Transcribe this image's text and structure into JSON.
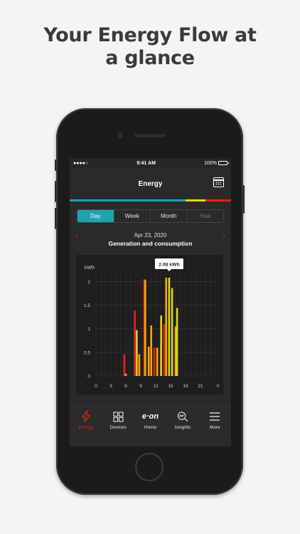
{
  "headline": {
    "line1": "Your Energy Flow at",
    "line2": "a glance"
  },
  "status_bar": {
    "signal": "●●●●○",
    "time": "9:41 AM",
    "battery": "100%"
  },
  "nav": {
    "title": "Energy",
    "right_icon": "calendar-icon"
  },
  "accent_colors": {
    "teal": "#1ea2b1",
    "yellow": "#e8d228",
    "red": "#e2231a",
    "orange": "#f5a800"
  },
  "tabs": [
    {
      "label": "Day",
      "state": "active"
    },
    {
      "label": "Week",
      "state": "normal"
    },
    {
      "label": "Month",
      "state": "normal"
    },
    {
      "label": "Year",
      "state": "disabled"
    }
  ],
  "date_header": {
    "prev_arrow": "‹",
    "next_arrow": "›",
    "date": "Apr 23, 2020",
    "subtitle": "Generation and consumption"
  },
  "chart_data": {
    "type": "bar",
    "title": "",
    "ylabel": "kWh",
    "xlabel": "h",
    "ylim": [
      0,
      2.2
    ],
    "xlim": [
      0,
      24
    ],
    "y_ticks": [
      0,
      0.5,
      1,
      1.5,
      2
    ],
    "y_tick_labels": [
      "0",
      "0.5",
      "1",
      "1.5",
      "2"
    ],
    "x_ticks": [
      0,
      3,
      6,
      9,
      12,
      15,
      18,
      21
    ],
    "x_tick_labels": [
      "0",
      "3",
      "6",
      "9",
      "12",
      "15",
      "18",
      "21"
    ],
    "grid": true,
    "tooltip": {
      "text": "2.08 kWh",
      "hour": 14.7
    },
    "series": [
      {
        "color": "#e2231a",
        "x": [
          5.7,
          7.8,
          9.7,
          11.7,
          13.7
        ],
        "values": [
          0.46,
          1.38,
          2.05,
          0.6,
          1.1
        ]
      },
      {
        "color": "#f5a800",
        "x": [
          6.0,
          8.7,
          9.9,
          10.6,
          11.1,
          12.3,
          13.1,
          14.1,
          16.0
        ],
        "values": [
          0.05,
          0.46,
          2.03,
          0.62,
          1.07,
          0.6,
          0.65,
          2.08,
          1.05
        ]
      },
      {
        "color": "#d7d820",
        "x": [
          8.2,
          13.1,
          14.7,
          15.3,
          16.3
        ],
        "values": [
          0.97,
          1.28,
          2.08,
          1.86,
          1.44
        ]
      }
    ]
  },
  "tab_bar": [
    {
      "label": "Energy",
      "icon": "lightning-icon",
      "active": true
    },
    {
      "label": "Devices",
      "icon": "devices-grid-icon",
      "active": false
    },
    {
      "label": "Home",
      "icon": "eon-logo",
      "logo_text": "e·on",
      "active": false
    },
    {
      "label": "Insights",
      "icon": "insights-magnifier-icon",
      "active": false
    },
    {
      "label": "More",
      "icon": "menu-icon",
      "active": false
    }
  ]
}
